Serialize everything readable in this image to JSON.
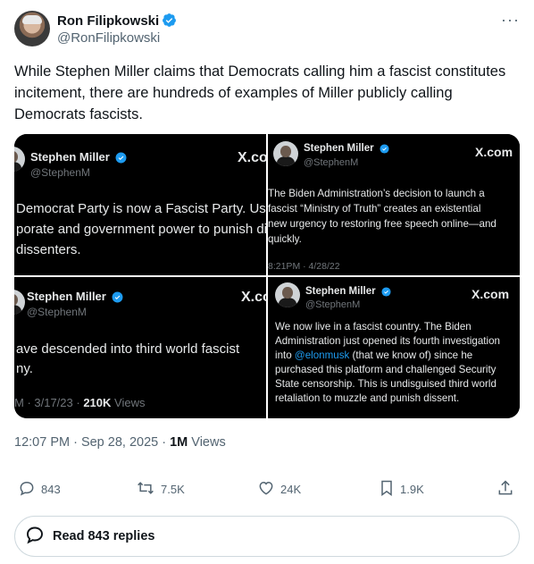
{
  "author": {
    "name": "Ron Filipkowski",
    "handle": "@RonFilipkowski"
  },
  "more_label": "···",
  "tweet": {
    "text": "While Stephen Miller claims that Democrats calling him a fascist constitutes incitement, there are hundreds of examples of Miller publicly calling Democrats fascists."
  },
  "media": {
    "q1": {
      "name": "Stephen Miller",
      "handle": "@StephenM",
      "brand": "X.co",
      "body": "Democrat Party is now a Fascist Party. Usir\nporate and government power to punish diss\ndissenters."
    },
    "q2": {
      "name": "Stephen Miller",
      "handle": "@StephenM",
      "brand": "X.com",
      "body": "The Biden Administration’s decision to launch a\nfascist “Ministry of Truth” creates an existential\nnew urgency to restoring free speech online—and\nquickly.",
      "meta": "8:21PM · 4/28/22"
    },
    "q3": {
      "name": "Stephen Miller",
      "handle": "@StephenM",
      "brand": "X.co",
      "body": "ave descended into third world fascist\nny.",
      "meta_date": "M · 3/17/23 ·",
      "meta_views_num": "210K",
      "meta_views_label": "Views"
    },
    "q4": {
      "name": "Stephen Miller",
      "handle": "@StephenM",
      "brand": "X.com",
      "body_pre": "We now live in a fascist country. The Biden\nAdministration just opened its fourth investigation\ninto ",
      "body_link": "@elonmusk",
      "body_post": " (that we know of) since he\npurchased this platform and challenged Security\nState censorship. This is undisguised third world\nretaliation to muzzle and punish dissent."
    }
  },
  "timestamp": {
    "time_date": "12:07 PM · Sep 28, 2025 · ",
    "views_num": "1M",
    "views_label": " Views"
  },
  "actions": {
    "replies": "843",
    "reposts": "7.5K",
    "likes": "24K",
    "bookmarks": "1.9K"
  },
  "read_replies": "Read 843 replies",
  "colors": {
    "verified": "#1d9bf0",
    "text": "#0f1419",
    "muted": "#536471"
  }
}
